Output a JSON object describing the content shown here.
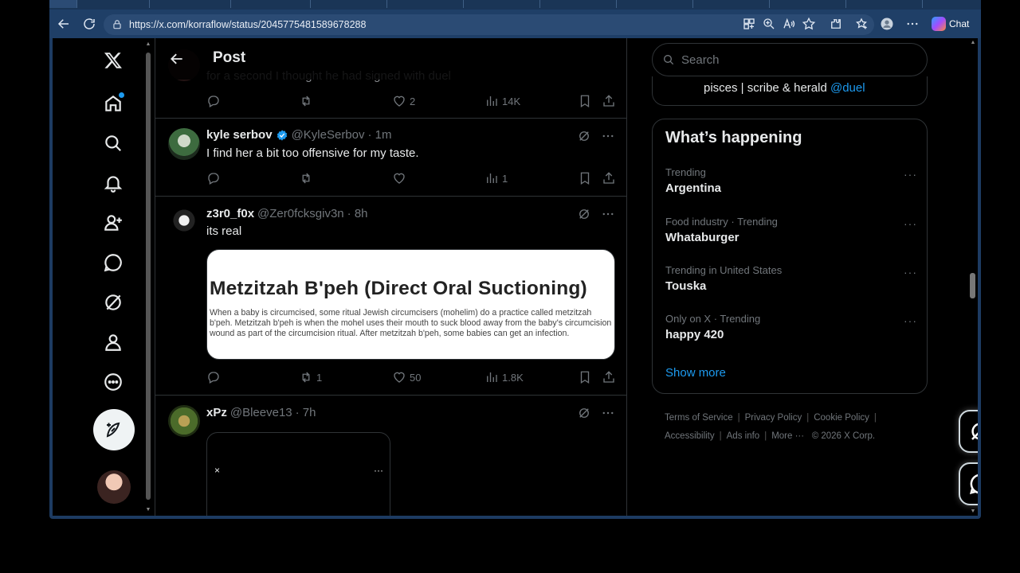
{
  "browser": {
    "url": "https://x.com/korraflow/status/2045775481589678288",
    "chat_label": "Chat"
  },
  "header": {
    "title": "Post"
  },
  "tweets": [
    {
      "text_partial": "for a second I thought he had signed with duel",
      "reply_count": "",
      "retweet_count": "",
      "like_count": "2",
      "view_count": "14K"
    },
    {
      "name": "kyle serbov",
      "handle": "@KyleSerbov",
      "time": "· 1m",
      "verified": true,
      "text": "I find her a bit too offensive for my taste.",
      "like_count": "",
      "view_count": "1"
    },
    {
      "name": "z3r0_f0x",
      "handle": "@Zer0fcksgiv3n",
      "time": "· 8h",
      "text": "its real",
      "card": {
        "title": "Metzitzah B'peh (Direct Oral Suctioning)",
        "body": "When a baby is circumcised, some ritual Jewish circumcisers (mohelim) do a practice called metzitzah b'peh. Metzitzah b'peh is when the mohel uses their mouth to suck blood away from the baby's circumcision wound as part of the circumcision ritual. After metzitzah b'peh, some babies can get an infection."
      },
      "retweet_count": "1",
      "like_count": "50",
      "view_count": "1.8K"
    },
    {
      "name": "xPz",
      "handle": "@Bleeve13",
      "time": "· 7h",
      "media_close": "×",
      "media_more": "···"
    }
  ],
  "sidebar": {
    "search_placeholder": "Search",
    "bio": {
      "text": "pisces | scribe & herald ",
      "link": "@duel"
    },
    "happening_title": "What’s happening",
    "trends": [
      {
        "context": "Trending",
        "name": "Argentina"
      },
      {
        "context": "Food industry · Trending",
        "name": "Whataburger"
      },
      {
        "context": "Trending in United States",
        "name": "Touska"
      },
      {
        "context": "Only on X · Trending",
        "name": "happy 420"
      }
    ],
    "trend_more": "···",
    "show_more": "Show more",
    "footer": {
      "terms": "Terms of Service",
      "privacy": "Privacy Policy",
      "cookie": "Cookie Policy",
      "accessibility": "Accessibility",
      "ads": "Ads info",
      "more": "More ···",
      "copyright": "© 2026 X Corp.",
      "sep": "|"
    }
  },
  "colors": {
    "accent": "#1d9bf0",
    "background": "#000000",
    "border": "#2f3336",
    "muted": "#71767b"
  }
}
